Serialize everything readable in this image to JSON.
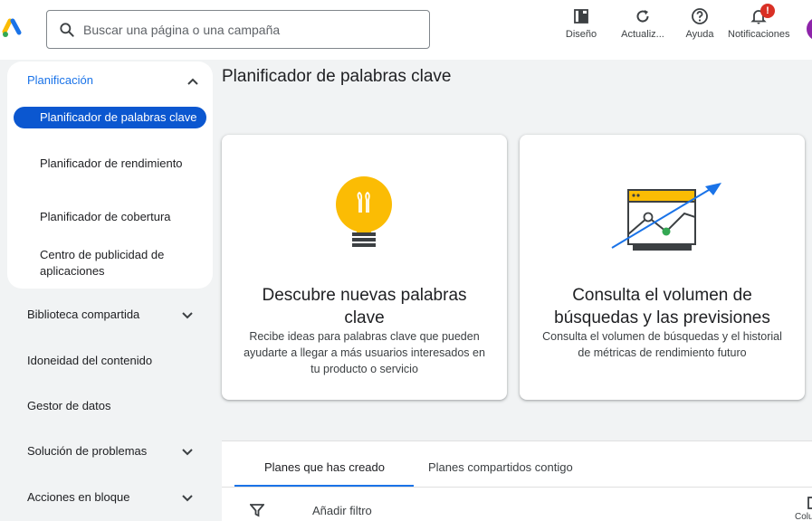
{
  "header": {
    "search_placeholder": "Buscar una página o una campaña",
    "tools": [
      {
        "label": "Diseño",
        "icon": "appearance-icon"
      },
      {
        "label": "Actualiz...",
        "icon": "refresh-icon"
      },
      {
        "label": "Ayuda",
        "icon": "help-icon"
      },
      {
        "label": "Notificaciones",
        "icon": "bell-icon",
        "badge": "!"
      }
    ]
  },
  "sidebar": {
    "section_title": "Planificación",
    "section_items": [
      {
        "label": "Planificador de palabras clave",
        "active": true
      },
      {
        "label": "Planificador de rendimiento",
        "active": false
      },
      {
        "label": "Planificador de cobertura",
        "active": false
      },
      {
        "label": "Centro de publicidad de aplicaciones",
        "active": false
      }
    ],
    "links": [
      {
        "label": "Biblioteca compartida",
        "expandable": true
      },
      {
        "label": "Idoneidad del contenido",
        "expandable": false
      },
      {
        "label": "Gestor de datos",
        "expandable": false
      },
      {
        "label": "Solución de problemas",
        "expandable": true
      },
      {
        "label": "Acciones en bloque",
        "expandable": true
      }
    ]
  },
  "main": {
    "title": "Planificador de palabras clave",
    "cards": [
      {
        "title": "Descubre nuevas palabras clave",
        "description": "Recibe ideas para palabras clave que pueden ayudarte a llegar a más usuarios interesados en tu producto o servicio",
        "icon": "lightbulb-icon"
      },
      {
        "title": "Consulta el volumen de búsquedas y las previsiones",
        "description": "Consulta el volumen de búsquedas y el historial de métricas de rendimiento futuro",
        "icon": "trend-chart-icon"
      }
    ],
    "tabs": [
      {
        "label": "Planes que has creado",
        "selected": true
      },
      {
        "label": "Planes compartidos contigo",
        "selected": false
      }
    ],
    "filter_label": "Añadir filtro",
    "columns_label": "Columnas"
  },
  "colors": {
    "accent": "#1a73e8",
    "active_nav": "#0b57d0",
    "badge": "#d93025",
    "bulb": "#fbbc04",
    "chart_arrow": "#1a73e8",
    "chart_point": "#34a853"
  }
}
